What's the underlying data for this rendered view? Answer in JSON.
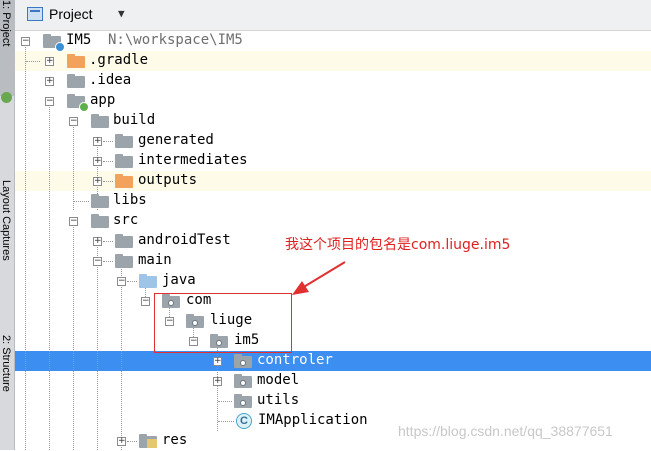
{
  "side_tabs": [
    "1: Project",
    "Layout Captures",
    "2: Structure"
  ],
  "header": {
    "title": "Project",
    "dropdown_icon": "chevron-down-icon"
  },
  "tree": [
    {
      "label": "IM5",
      "path": "N:\\workspace\\IM5",
      "icon": "module-folder",
      "expanded": true,
      "highlight": false,
      "selected": false
    },
    {
      "label": ".gradle",
      "icon": "folder-orange",
      "expanded": false,
      "highlight": true
    },
    {
      "label": ".idea",
      "icon": "folder-gray",
      "expanded": false
    },
    {
      "label": "app",
      "icon": "module-folder",
      "expanded": true
    },
    {
      "label": "build",
      "icon": "folder-gray",
      "expanded": true
    },
    {
      "label": "generated",
      "icon": "folder-gray",
      "expanded": false
    },
    {
      "label": "intermediates",
      "icon": "folder-gray",
      "expanded": false
    },
    {
      "label": "outputs",
      "icon": "folder-orange",
      "expanded": false,
      "highlight": true
    },
    {
      "label": "libs",
      "icon": "folder-gray"
    },
    {
      "label": "src",
      "icon": "folder-gray",
      "expanded": true
    },
    {
      "label": "androidTest",
      "icon": "folder-gray",
      "expanded": false
    },
    {
      "label": "main",
      "icon": "folder-gray",
      "expanded": true
    },
    {
      "label": "java",
      "icon": "folder-blue",
      "expanded": true
    },
    {
      "label": "com",
      "icon": "package",
      "expanded": true
    },
    {
      "label": "liuge",
      "icon": "package",
      "expanded": true
    },
    {
      "label": "im5",
      "icon": "package",
      "expanded": true
    },
    {
      "label": "controler",
      "icon": "package",
      "expanded": false,
      "selected": true
    },
    {
      "label": "model",
      "icon": "package",
      "expanded": false
    },
    {
      "label": "utils",
      "icon": "package"
    },
    {
      "label": "IMApplication",
      "icon": "class"
    },
    {
      "label": "res",
      "icon": "resource-folder",
      "expanded": false
    }
  ],
  "annotation": {
    "text": "我这个项目的包名是com.liuge.im5",
    "color": "#e02020"
  },
  "watermark": "https://blog.csdn.net/qq_38877651",
  "colors": {
    "selection": "#3c8ff0",
    "highlight": "#fefce9",
    "annotation": "#e02020"
  }
}
